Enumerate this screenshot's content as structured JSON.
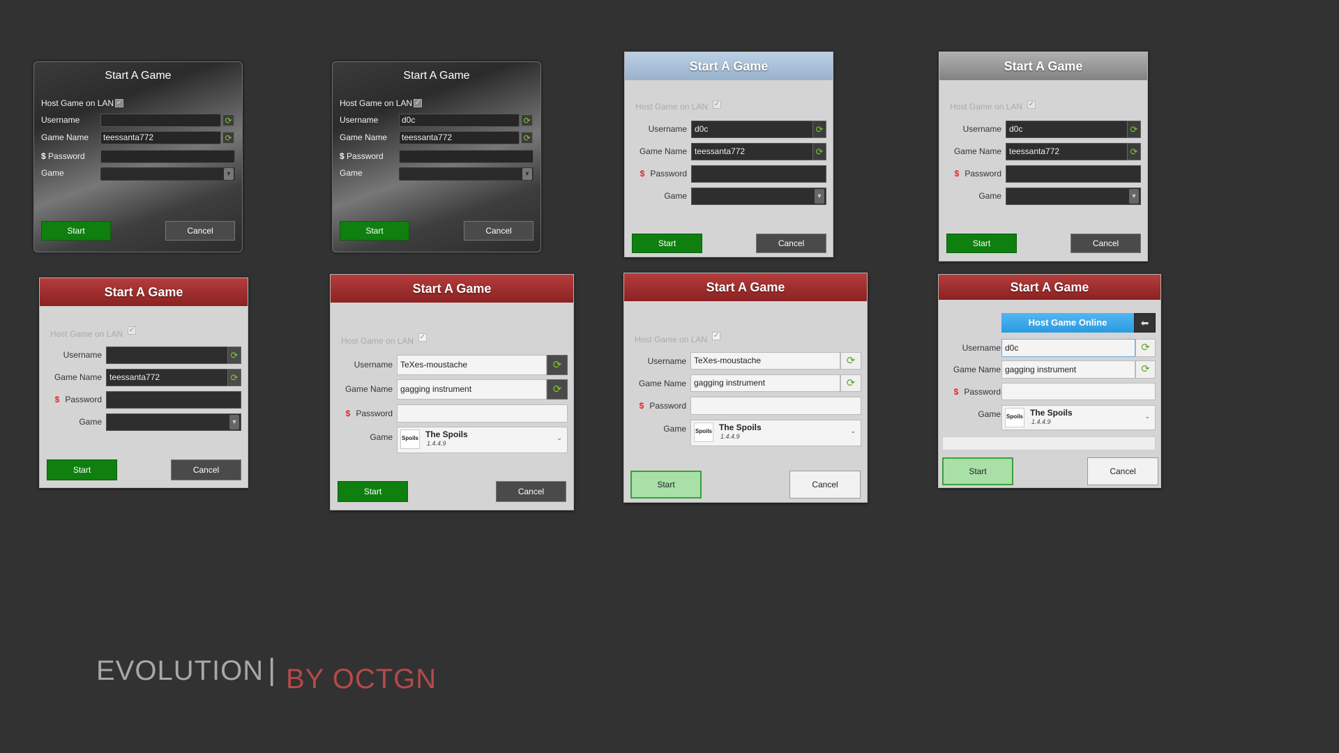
{
  "dialog_title": "Start A Game",
  "labels": {
    "host_lan": "Host Game on LAN",
    "username": "Username",
    "game_name": "Game Name",
    "password": "Password",
    "password_symbol": "$",
    "game": "Game"
  },
  "buttons": {
    "start": "Start",
    "cancel": "Cancel"
  },
  "host_online": "Host Game Online",
  "game_selection": {
    "name": "The Spoils",
    "version": "1.4.4.9",
    "logo_text": "Spoils"
  },
  "dialogs": [
    {
      "username": "",
      "game_name": "teessanta772"
    },
    {
      "username": "d0c",
      "game_name": "teessanta772"
    },
    {
      "username": "d0c",
      "game_name": "teessanta772"
    },
    {
      "username": "d0c",
      "game_name": "teessanta772"
    },
    {
      "username": "",
      "game_name": "teessanta772"
    },
    {
      "username": "TeXes-moustache",
      "game_name": "gagging instrument"
    },
    {
      "username": "TeXes-moustache",
      "game_name": "gagging instrument"
    },
    {
      "username": "d0c",
      "game_name": "gagging instrument"
    }
  ],
  "footer": {
    "evolution": "EVOLUTION",
    "separator": "|",
    "by": "BY OCTGN"
  },
  "icons": {
    "refresh": "refresh-icon",
    "check": "checkmark-icon",
    "dropdown": "chevron-down-icon",
    "back": "back-arrow-icon"
  },
  "colors": {
    "start_green": "#0f7f0f",
    "title_red": "#8b2222",
    "host_blue": "#2a9ae0",
    "background": "#323232"
  }
}
